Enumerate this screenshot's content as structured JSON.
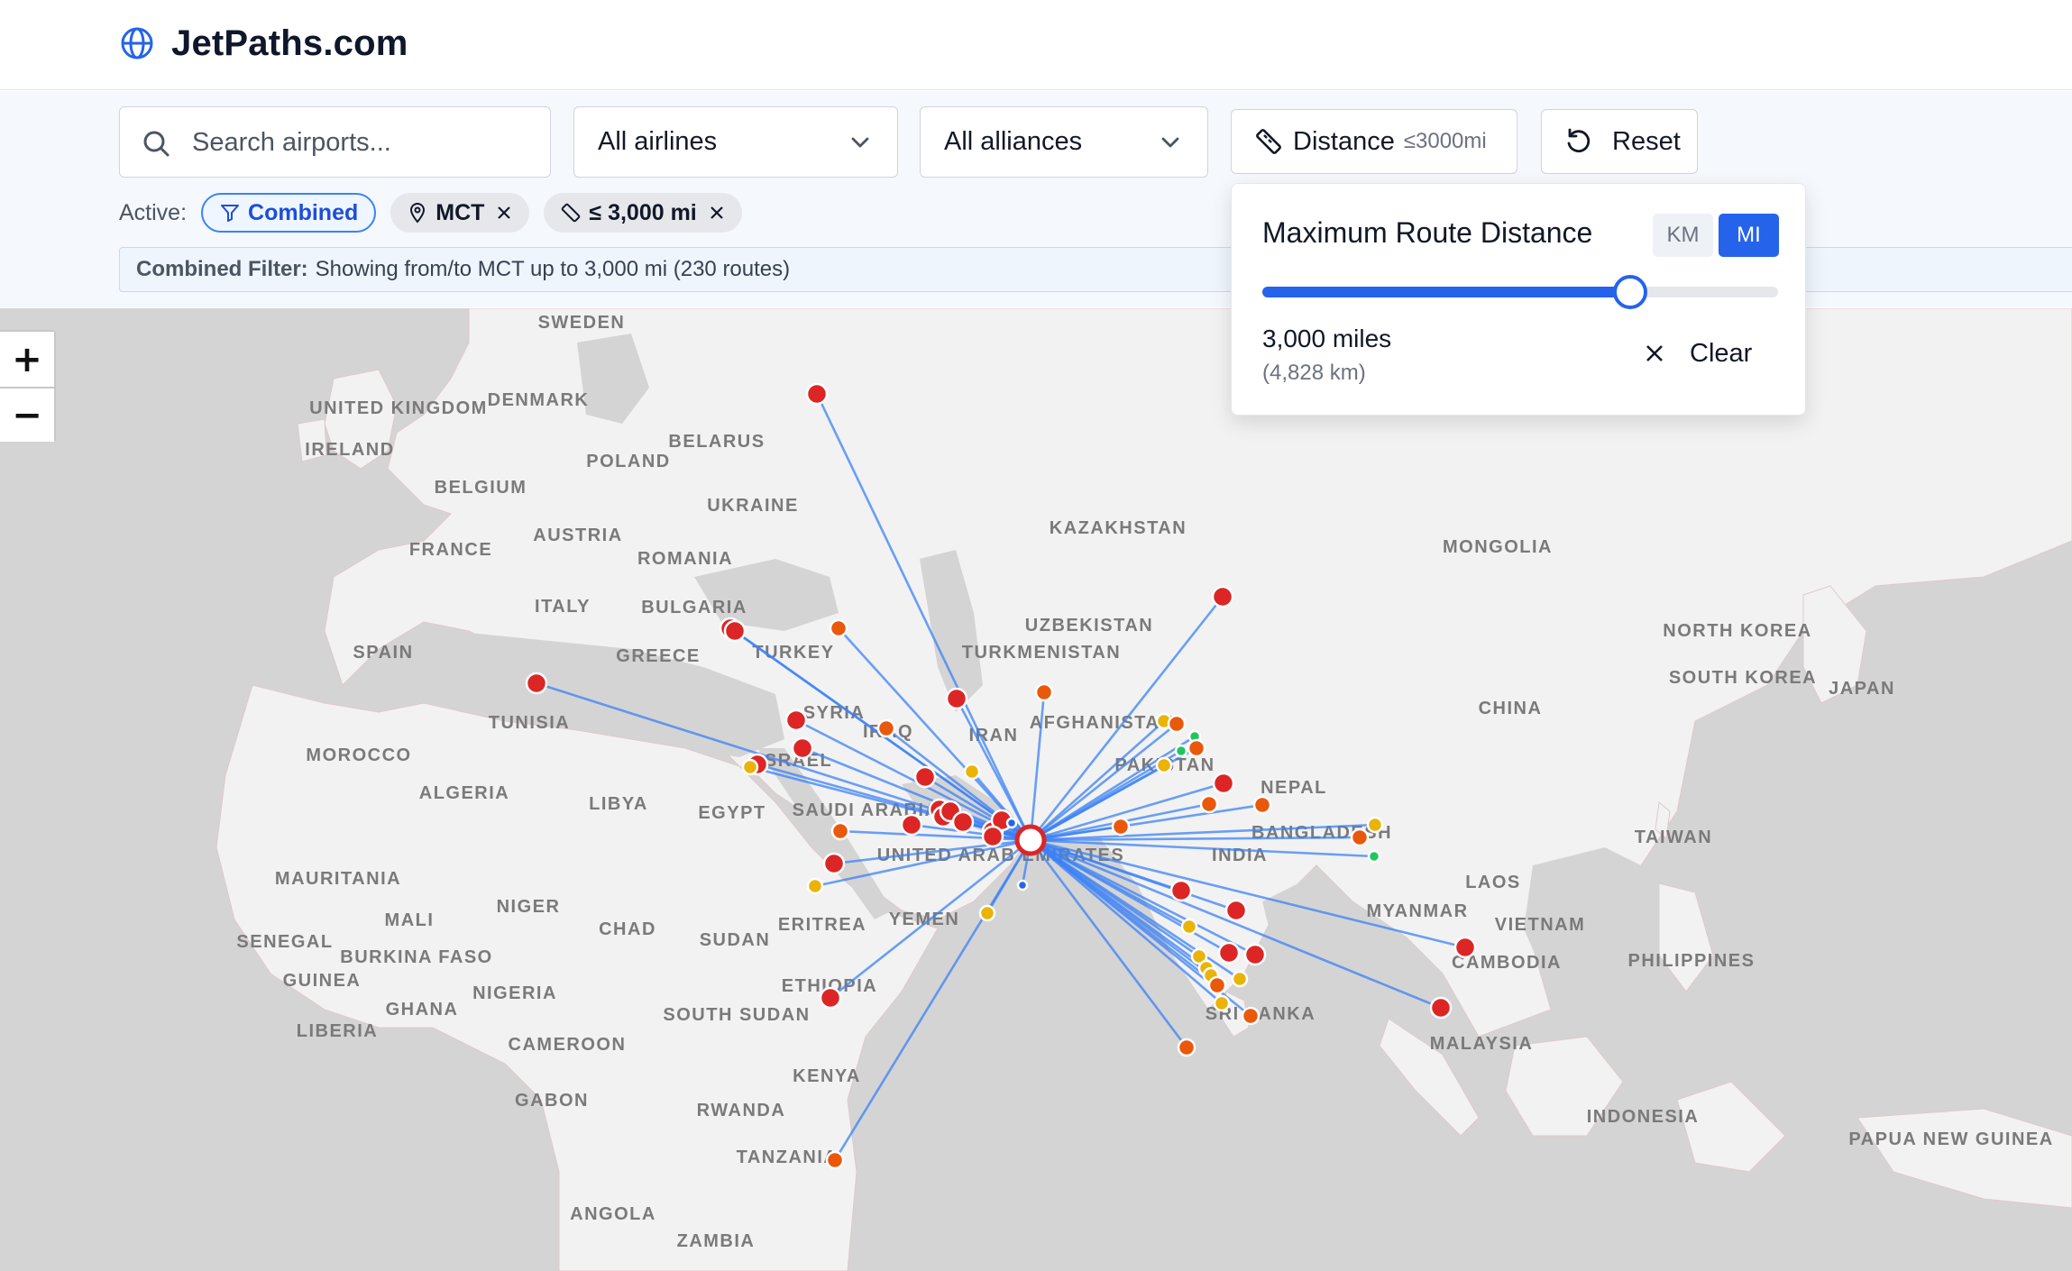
{
  "header": {
    "brand_name": "JetPaths.com",
    "brand_icon": "globe-icon"
  },
  "filters": {
    "search_placeholder": "Search airports...",
    "search_value": "",
    "airlines_value": "All airlines",
    "alliances_value": "All alliances",
    "distance_label": "Distance",
    "distance_sub": "≤3000mi",
    "reset_label": "Reset"
  },
  "active": {
    "label": "Active:",
    "chips": [
      {
        "label": "Combined",
        "icon": "filter-icon",
        "removable": false
      },
      {
        "label": "MCT",
        "icon": "map-pin-icon",
        "removable": true
      },
      {
        "label": "≤ 3,000 mi",
        "icon": "ruler-icon",
        "removable": true
      }
    ]
  },
  "info": {
    "prefix": "Combined Filter:",
    "text": "Showing from/to MCT up to 3,000 mi (230 routes)"
  },
  "popover": {
    "title": "Maximum Route Distance",
    "unit_km": "KM",
    "unit_mi": "MI",
    "selected_unit": "MI",
    "value_text": "3,000 miles",
    "km_text": "(4,828 km)",
    "slider_fraction": 0.714,
    "clear_label": "Clear"
  },
  "map": {
    "zoom_in": "+",
    "zoom_out": "−",
    "hub": "MCT",
    "colors": {
      "route": "#3b82f6",
      "red": "#dc2626",
      "orange": "#ea580c",
      "yellow": "#eab308",
      "green": "#22c55e",
      "blue": "#2563eb"
    },
    "country_labels": [
      "SWEDEN",
      "DENMARK",
      "UNITED KINGDOM",
      "IRELAND",
      "BELARUS",
      "POLAND",
      "BELGIUM",
      "UKRAINE",
      "FRANCE",
      "AUSTRIA",
      "ROMANIA",
      "ITALY",
      "BULGARIA",
      "SPAIN",
      "GREECE",
      "TURKEY",
      "KAZAKHSTAN",
      "MONGOLIA",
      "UZBEKISTAN",
      "TURKMENISTAN",
      "NORTH KOREA",
      "SOUTH KOREA",
      "JAPAN",
      "CHINA",
      "TUNISIA",
      "SYRIA",
      "IRAQ",
      "IRAN",
      "AFGHANISTAN",
      "PAKISTAN",
      "MOROCCO",
      "ALGERIA",
      "LIBYA",
      "ISRAEL",
      "EGYPT",
      "SAUDI ARABIA",
      "NEPAL",
      "BANGLADESH",
      "INDIA",
      "TAIWAN",
      "UNITED ARAB EMIRATES",
      "MAURITANIA",
      "MALI",
      "NIGER",
      "CHAD",
      "SUDAN",
      "ERITREA",
      "YEMEN",
      "LAOS",
      "MYANMAR",
      "VIETNAM",
      "SENEGAL",
      "BURKINA FASO",
      "GUINEA",
      "NIGERIA",
      "GHANA",
      "LIBERIA",
      "SOUTH SUDAN",
      "ETHIOPIA",
      "CAMBODIA",
      "PHILIPPINES",
      "SRI LANKA",
      "CAMEROON",
      "MALAYSIA",
      "KENYA",
      "GABON",
      "RWANDA",
      "INDONESIA",
      "TANZANIA",
      "PAPUA NEW GUINEA",
      "ANGOLA",
      "ZAMBIA"
    ]
  }
}
